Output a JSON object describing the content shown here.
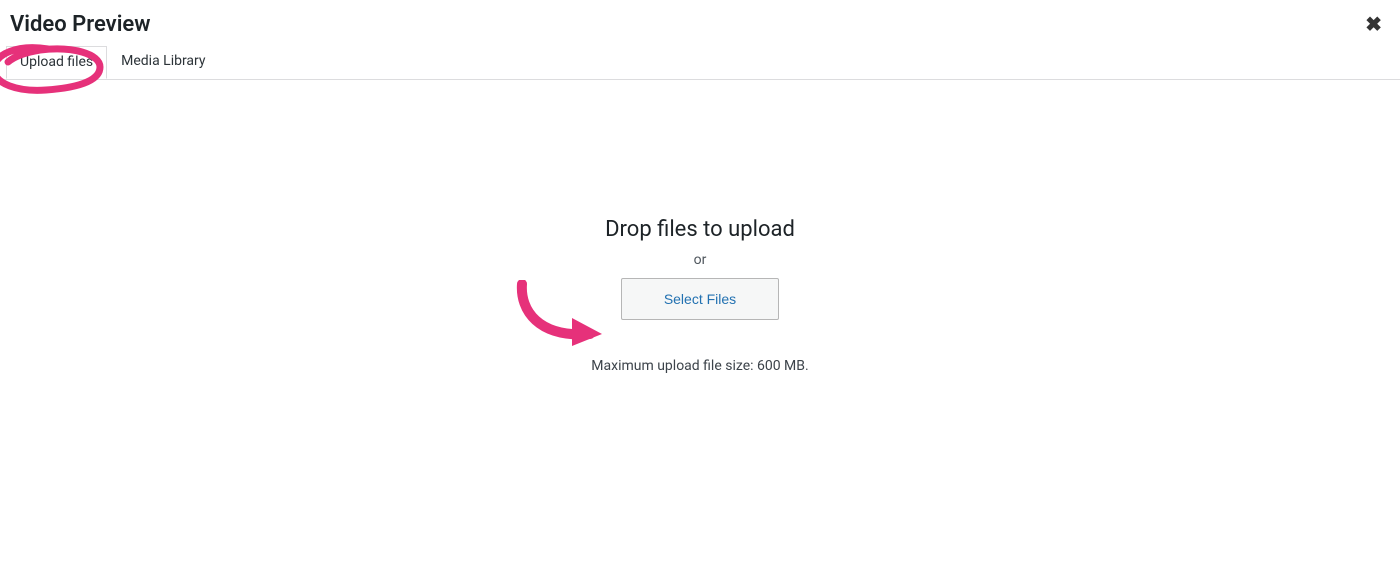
{
  "header": {
    "title": "Video Preview",
    "close_glyph": "✖"
  },
  "tabs": {
    "upload_label": "Upload files",
    "library_label": "Media Library"
  },
  "upload": {
    "drop_title": "Drop files to upload",
    "or": "or",
    "select_button": "Select Files",
    "max_size": "Maximum upload file size: 600 MB."
  },
  "annotation_color": "#e6317a"
}
